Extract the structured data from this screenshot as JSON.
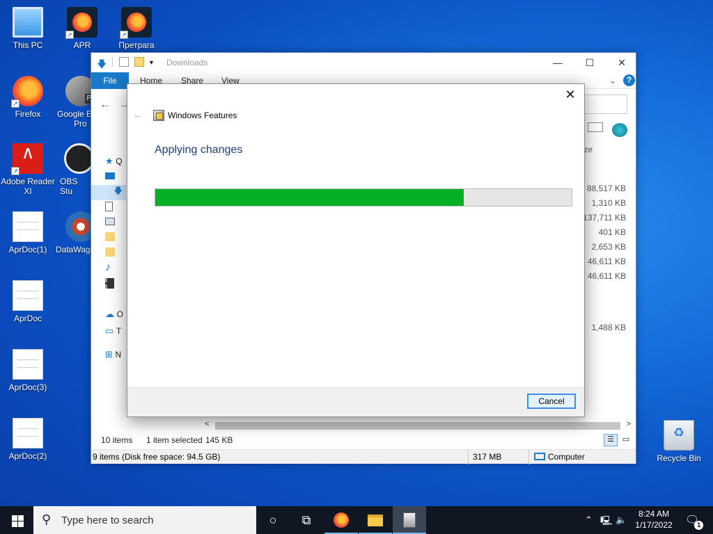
{
  "desktop": {
    "icons": [
      {
        "label": "This PC",
        "icon": "computer-icon"
      },
      {
        "label": "APR",
        "icon": "firefox-icon"
      },
      {
        "label": "Претрага",
        "icon": "firefox-icon"
      },
      {
        "label": "Firefox",
        "icon": "firefox-icon"
      },
      {
        "label": "Google E",
        "label2": "Pro",
        "icon": "google-earth-icon",
        "badge": "Pro"
      },
      {
        "label": "Adobe Reader",
        "label2": "XI",
        "icon": "adobe-reader-icon"
      },
      {
        "label": "OBS Stu",
        "icon": "obs-icon"
      },
      {
        "label": "AprDoc(1)",
        "icon": "document-icon"
      },
      {
        "label": "DataWag",
        "icon": "datawagon-icon"
      },
      {
        "label": "AprDoc",
        "icon": "document-icon"
      },
      {
        "label": "AprDoc(3)",
        "icon": "document-icon"
      },
      {
        "label": "AprDoc(2)",
        "icon": "document-icon"
      },
      {
        "label": "Recycle Bin",
        "icon": "recycle-bin-icon"
      }
    ]
  },
  "explorer": {
    "title": "Downloads",
    "ribbon": {
      "file": "File",
      "home": "Home",
      "share": "Share",
      "view": "View"
    },
    "column_header_partial": "ze",
    "sizes": [
      "88,517 KB",
      "1,310 KB",
      "137,711 KB",
      "401 KB",
      "2,653 KB",
      "46,611 KB",
      "46,611 KB",
      "1,488 KB"
    ],
    "sidebar_partial": {
      "quick": "Q",
      "onedrive": "O",
      "thispc": "T",
      "network": "N"
    },
    "status": {
      "items": "10 items",
      "selected": "1 item selected",
      "selected_size": "145 KB"
    },
    "bottom": {
      "disk": "9 items (Disk free space: 94.5 GB)",
      "size": "317 MB",
      "location": "Computer"
    },
    "window_buttons": {
      "minimize": "—",
      "maximize": "☐",
      "close": "✕"
    }
  },
  "dialog": {
    "title": "Windows Features",
    "heading": "Applying changes",
    "progress": 0.74,
    "progress_color": "#06b025",
    "cancel": "Cancel",
    "close": "✕",
    "back": "←"
  },
  "taskbar": {
    "search_placeholder": "Type here to search",
    "time": "8:24 AM",
    "date": "1/17/2022",
    "notification_count": "1"
  }
}
